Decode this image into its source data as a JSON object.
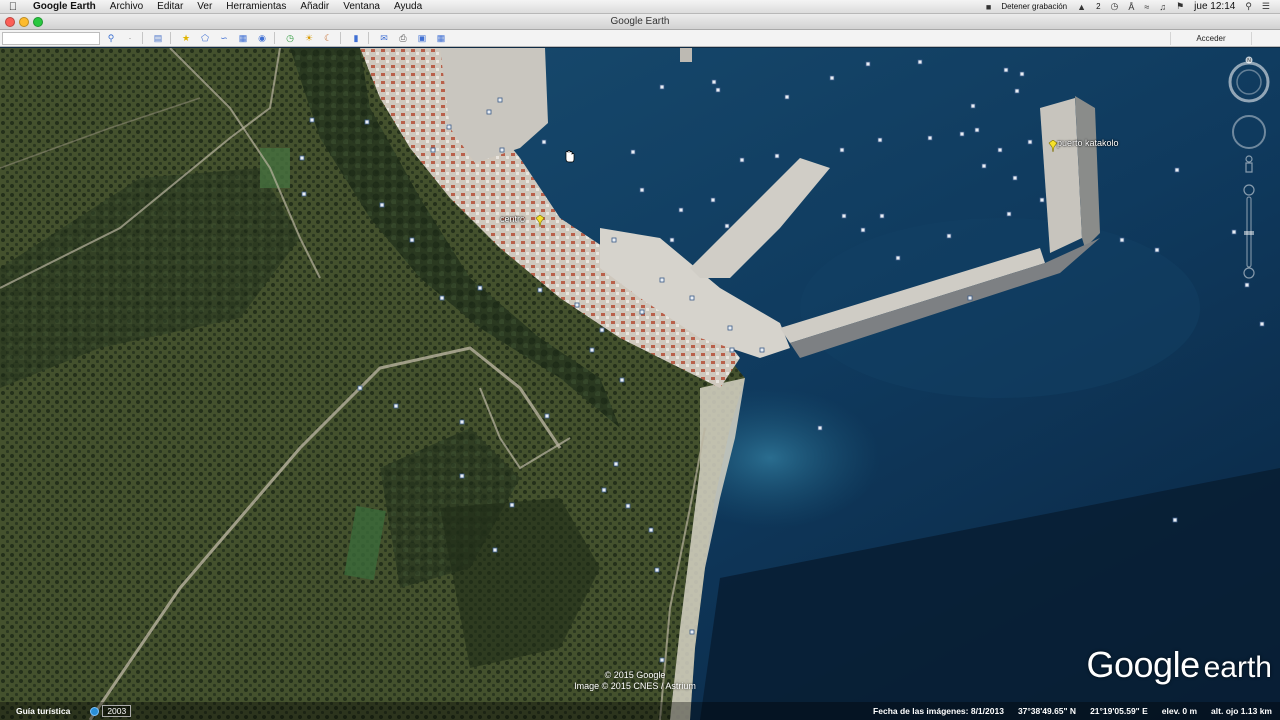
{
  "menubar": {
    "app_name": "Google Earth",
    "items": [
      "Archivo",
      "Editar",
      "Ver",
      "Herramientas",
      "Añadir",
      "Ventana",
      "Ayuda"
    ],
    "status": {
      "recording": "Detener grabación",
      "a_count": "2",
      "clock": "jue 12:14"
    }
  },
  "window": {
    "title": "Google Earth"
  },
  "toolbar": {
    "signin_label": "Acceder"
  },
  "map": {
    "placemarks": [
      {
        "label": "centro"
      },
      {
        "label": "puerto katakolo"
      }
    ],
    "copyright_line1": "© 2015 Google",
    "copyright_line2": "Image © 2015 CNES / Astrium",
    "logo_left": "Google",
    "logo_right": "earth"
  },
  "statusbar": {
    "tour_guide": "Guía turística",
    "year": "2003",
    "imagery_date": "Fecha de las imágenes: 8/1/2013",
    "latitude": "37°38'49.65\" N",
    "longitude": "21°19'05.59\" E",
    "elevation": "elev.    0 m",
    "eye_altitude": "alt. ojo   1.13 km"
  },
  "colors": {
    "sea_deep": "#0b2a46",
    "sea_shallow": "#1d5a7c",
    "land": "#2f3e22",
    "town": "#d8d4cc",
    "placemark_yellow": "#f5e12c"
  }
}
